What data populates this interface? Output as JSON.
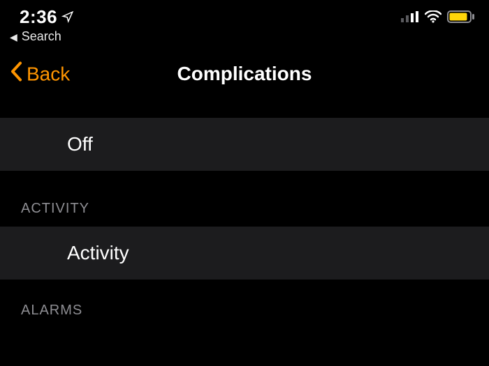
{
  "status": {
    "time": "2:36",
    "location_icon": "location-arrow"
  },
  "breadcrumb": {
    "label": "Search"
  },
  "nav": {
    "back_label": "Back",
    "title": "Complications"
  },
  "colors": {
    "accent": "#ff9500",
    "battery_fill": "#ffd60a"
  },
  "list": {
    "off_label": "Off",
    "sections": [
      {
        "header": "ACTIVITY",
        "items": [
          {
            "label": "Activity"
          }
        ]
      },
      {
        "header": "ALARMS",
        "items": []
      }
    ]
  }
}
